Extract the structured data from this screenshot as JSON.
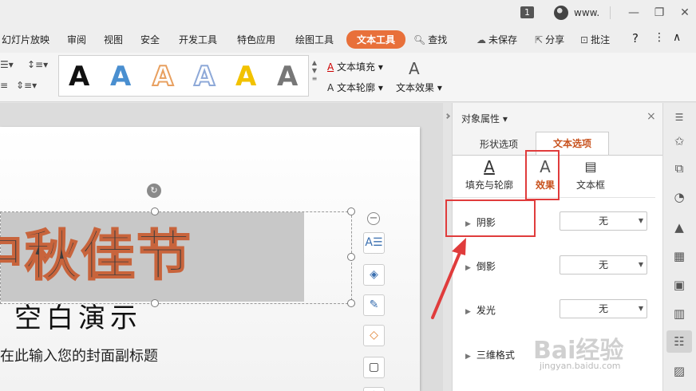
{
  "window": {
    "badge": "1",
    "user_name": "www.",
    "min_icon": "minimize-icon",
    "restore_icon": "restore-icon",
    "close_icon": "close-icon"
  },
  "tabs": [
    {
      "label": "幻灯片放映"
    },
    {
      "label": "审阅"
    },
    {
      "label": "视图"
    },
    {
      "label": "安全"
    },
    {
      "label": "开发工具"
    },
    {
      "label": "特色应用"
    },
    {
      "label": "绘图工具"
    },
    {
      "label": "文本工具",
      "active": true
    },
    {
      "label": "查找"
    }
  ],
  "tab_right": {
    "unsaved": "未保存",
    "share": "分享",
    "comment": "批注",
    "help": "?",
    "more": "⋮",
    "collapse": "∧"
  },
  "ribbon": {
    "gallery_letter": "A",
    "gallery_colors": [
      "#111111",
      "#4a8fd0",
      "#e8a060",
      "#8ea9d8",
      "#f2c200",
      "#777777"
    ],
    "text_fill": "文本填充",
    "text_outline": "文本轮廓",
    "text_effect": "文本效果"
  },
  "slide": {
    "title": "中秋佳节",
    "subtitle": "空白演示",
    "subtitle2": "在此输入您的封面副标题",
    "title_stroke_color": "#c8643c"
  },
  "panel": {
    "title": "对象属性",
    "close": "×",
    "tabs": [
      "形状选项",
      "文本选项"
    ],
    "active_tab": "文本选项",
    "subtabs": [
      "填充与轮廓",
      "效果",
      "文本框"
    ],
    "active_subtab": "效果",
    "rows": [
      {
        "label": "阴影",
        "value": "无"
      },
      {
        "label": "倒影",
        "value": "无"
      },
      {
        "label": "发光",
        "value": "无"
      },
      {
        "label": "三维格式",
        "value": ""
      }
    ],
    "highlight_color": "#e03c3c"
  },
  "watermark": {
    "text": "Bai经验",
    "url": "jingyan.baidu.com"
  }
}
